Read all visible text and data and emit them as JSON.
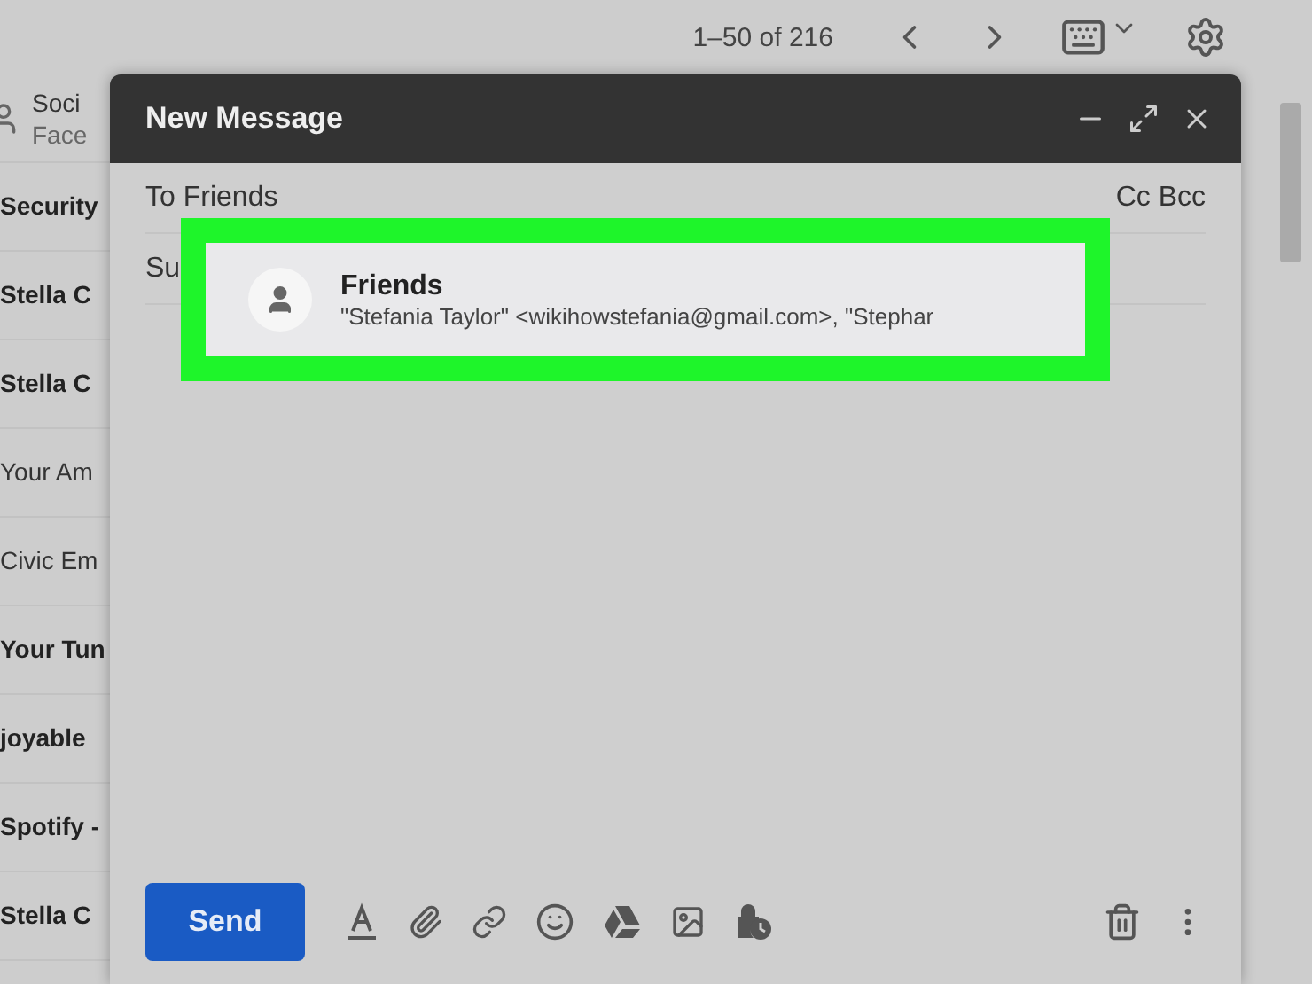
{
  "toolbar": {
    "pager": "1–50 of 216"
  },
  "inbox_rows": [
    {
      "text": "Soci",
      "subtext": "Face",
      "bold": false,
      "avatar": true
    },
    {
      "text": "Security",
      "bold": true
    },
    {
      "text": "Stella C",
      "bold": true
    },
    {
      "text": "Stella C",
      "bold": true
    },
    {
      "text": "Your Am",
      "bold": false
    },
    {
      "text": "Civic Em",
      "bold": false
    },
    {
      "text": "Your Tun",
      "bold": true
    },
    {
      "text": "joyable",
      "bold": true
    },
    {
      "text": "Spotify -",
      "bold": true
    },
    {
      "text": "Stella C",
      "bold": true
    }
  ],
  "compose": {
    "title": "New Message",
    "to_label": "To",
    "to_value": "Friends",
    "cc_bcc": "Cc Bcc",
    "subject_label": "Su",
    "send": "Send"
  },
  "suggestion": {
    "name": "Friends",
    "detail": "\"Stefania Taylor\" <wikihowstefania@gmail.com>, \"Stephar"
  }
}
